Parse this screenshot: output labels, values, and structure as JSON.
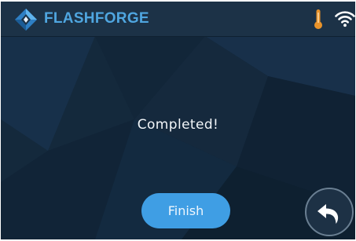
{
  "header": {
    "brand": "FLASHFORGE",
    "logo_icon": "flashforge-logo-icon",
    "temperature_icon": "thermometer-icon",
    "wifi_icon": "wifi-icon"
  },
  "main": {
    "message": "Completed!"
  },
  "actions": {
    "finish_label": "Finish",
    "back_icon": "back-arrow-icon"
  },
  "colors": {
    "background": "#14293c",
    "header": "#1c3247",
    "brand_text": "#4fa6e0",
    "accent_button": "#3f9ee4",
    "thermometer": "#e9932a"
  }
}
